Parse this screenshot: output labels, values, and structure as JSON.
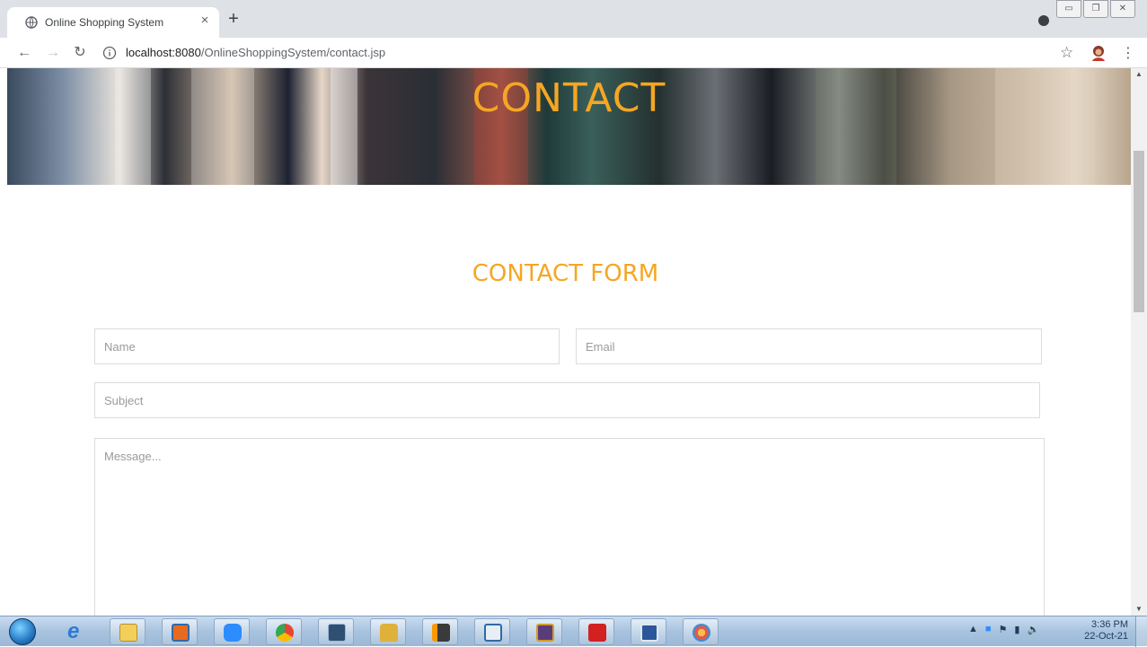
{
  "browser": {
    "tab_title": "Online Shopping System",
    "tab_close": "×",
    "new_tab": "+",
    "url_host": "localhost:8080",
    "url_path": "/OnlineShoppingSystem/contact.jsp",
    "window_controls": [
      "▭",
      "❐",
      "✕"
    ]
  },
  "page": {
    "banner_title": "CONTACT",
    "form_heading": "CONTACT FORM",
    "form": {
      "name_placeholder": "Name",
      "email_placeholder": "Email",
      "subject_placeholder": "Subject",
      "message_placeholder": "Message..."
    }
  },
  "taskbar": {
    "apps": [
      "internet-explorer",
      "file-explorer",
      "media-player",
      "zoom",
      "chrome",
      "snipping-tool",
      "lock-app",
      "sublime-text",
      "notepad-window",
      "java-ide",
      "acrobat-reader",
      "word",
      "paint"
    ],
    "time": "3:36 PM",
    "date": "22-Oct-21"
  },
  "colors": {
    "accent": "#f5a623",
    "tab_strip": "#dee1e6",
    "taskbar": "#a8c3df"
  }
}
